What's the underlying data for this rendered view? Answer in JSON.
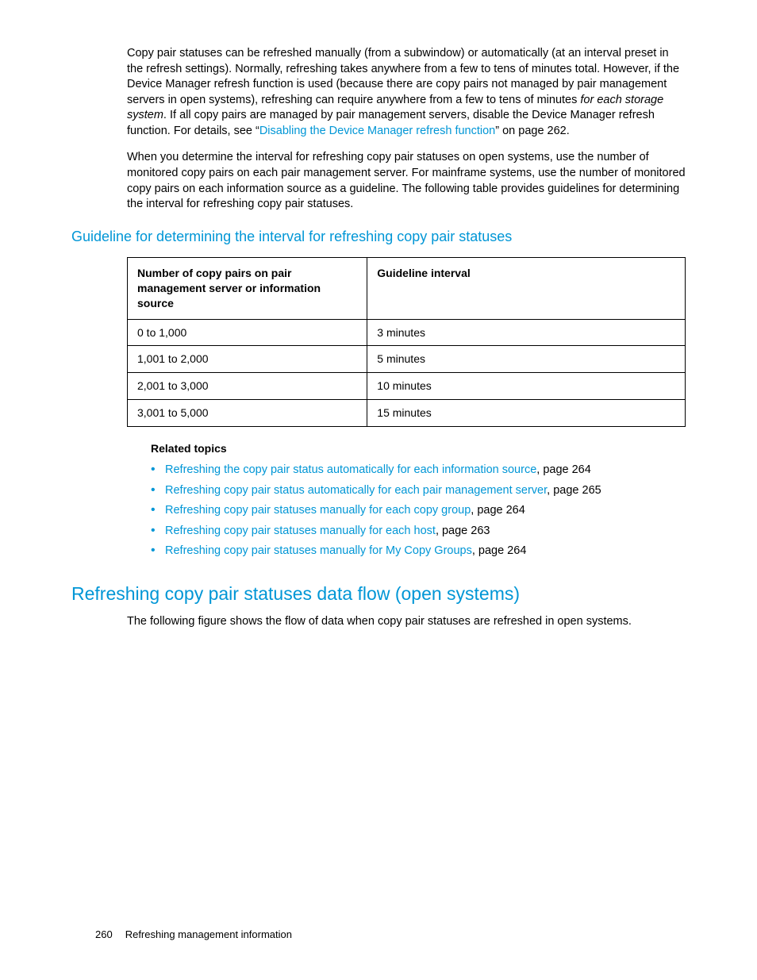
{
  "para1": {
    "t1": "Copy pair statuses can be refreshed manually (from a subwindow) or automatically (at an interval preset in the refresh settings). Normally, refreshing takes anywhere from a few to tens of minutes total. However, if the Device Manager refresh function is used (because there are copy pairs not managed by pair management servers in open systems), refreshing can require anywhere from a few to tens of minutes ",
    "italic": "for each storage system",
    "t2": ". If all copy pairs are managed by pair management servers, disable the Device Manager refresh function. For details, see “",
    "link": "Disabling the Device Manager refresh function",
    "t3": "” on page 262."
  },
  "para2": "When you determine the interval for refreshing copy pair statuses on open systems, use the number of monitored copy pairs on each pair management server. For mainframe systems, use the number of monitored copy pairs on each information source as a guideline. The following table provides guidelines for determining the interval for refreshing copy pair statuses.",
  "h3": "Guideline for determining the interval for refreshing copy pair statuses",
  "table": {
    "headers": [
      "Number of copy pairs on pair management server or information source",
      "Guideline interval"
    ],
    "rows": [
      [
        "0 to 1,000",
        "3 minutes"
      ],
      [
        "1,001 to 2,000",
        "5 minutes"
      ],
      [
        "2,001 to 3,000",
        "10 minutes"
      ],
      [
        "3,001 to 5,000",
        "15 minutes"
      ]
    ]
  },
  "related_heading": "Related topics",
  "related": [
    {
      "link": "Refreshing the copy pair status automatically for each information source",
      "suffix": ", page 264"
    },
    {
      "link": "Refreshing copy pair status automatically for each pair management server",
      "suffix": ", page 265"
    },
    {
      "link": "Refreshing copy pair statuses manually for each copy group",
      "suffix": ", page 264"
    },
    {
      "link": "Refreshing copy pair statuses manually for each host",
      "suffix": ", page 263"
    },
    {
      "link": "Refreshing copy pair statuses manually for My Copy Groups",
      "suffix": ", page 264"
    }
  ],
  "h2": "Refreshing copy pair statuses data flow (open systems)",
  "para3": "The following figure shows the flow of data when copy pair statuses are refreshed in open systems.",
  "footer": {
    "page": "260",
    "title": "Refreshing management information"
  }
}
